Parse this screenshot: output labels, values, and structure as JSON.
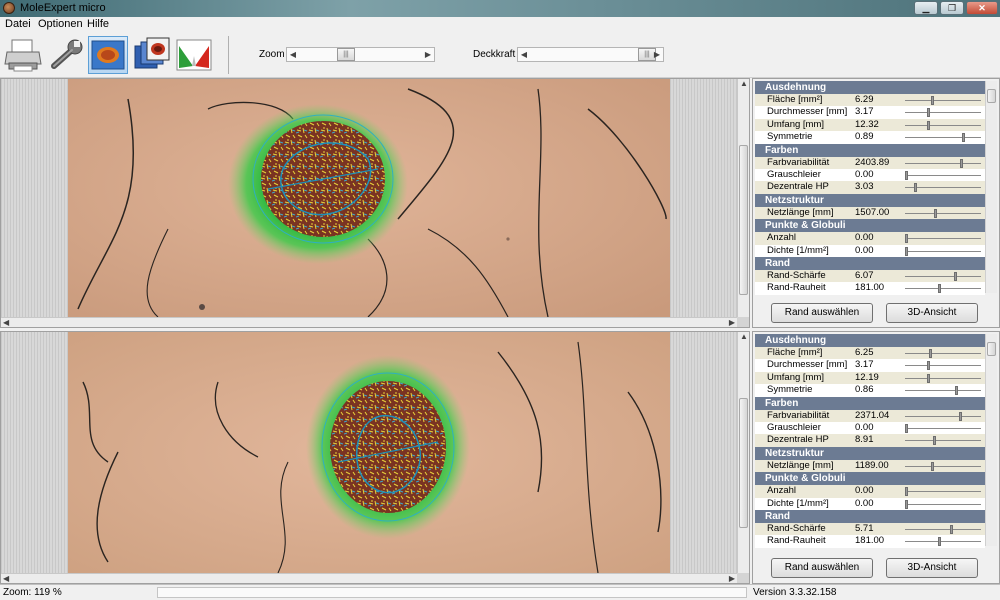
{
  "window": {
    "title": "MoleExpert micro"
  },
  "menu": [
    "Datei",
    "Optionen",
    "Hilfe"
  ],
  "toolbar": {
    "zoom_label": "Zoom",
    "opacity_label": "Deckkraft"
  },
  "panels": [
    {
      "sections": [
        {
          "title": "Ausdehnung",
          "rows": [
            {
              "name": "Fläche [mm²]",
              "value": "6.29",
              "level": 0.35
            },
            {
              "name": "Durchmesser [mm]",
              "value": "3.17",
              "level": 0.3
            },
            {
              "name": "Umfang [mm]",
              "value": "12.32",
              "level": 0.3
            },
            {
              "name": "Symmetrie",
              "value": "0.89",
              "level": 0.78
            }
          ]
        },
        {
          "title": "Farben",
          "rows": [
            {
              "name": "Farbvariabilität",
              "value": "2403.89",
              "level": 0.75
            },
            {
              "name": "Grauschleier",
              "value": "0.00",
              "level": 0.0
            },
            {
              "name": "Dezentrale HP",
              "value": "3.03",
              "level": 0.12
            }
          ]
        },
        {
          "title": "Netzstruktur",
          "rows": [
            {
              "name": "Netzlänge [mm]",
              "value": "1507.00",
              "level": 0.4
            }
          ]
        },
        {
          "title": "Punkte & Globuli",
          "rows": [
            {
              "name": "Anzahl",
              "value": "0.00",
              "level": 0.0
            },
            {
              "name": "Dichte [1/mm²]",
              "value": "0.00",
              "level": 0.0
            }
          ]
        },
        {
          "title": "Rand",
          "rows": [
            {
              "name": "Rand-Schärfe",
              "value": "6.07",
              "level": 0.67
            },
            {
              "name": "Rand-Rauheit",
              "value": "181.00",
              "level": 0.45
            }
          ]
        }
      ],
      "btn_border": "Rand auswählen",
      "btn_3d": "3D-Ansicht"
    },
    {
      "sections": [
        {
          "title": "Ausdehnung",
          "rows": [
            {
              "name": "Fläche [mm²]",
              "value": "6.25",
              "level": 0.33
            },
            {
              "name": "Durchmesser [mm]",
              "value": "3.17",
              "level": 0.3
            },
            {
              "name": "Umfang [mm]",
              "value": "12.19",
              "level": 0.3
            },
            {
              "name": "Symmetrie",
              "value": "0.86",
              "level": 0.68
            }
          ]
        },
        {
          "title": "Farben",
          "rows": [
            {
              "name": "Farbvariabilität",
              "value": "2371.04",
              "level": 0.74
            },
            {
              "name": "Grauschleier",
              "value": "0.00",
              "level": 0.0
            },
            {
              "name": "Dezentrale HP",
              "value": "8.91",
              "level": 0.38
            }
          ]
        },
        {
          "title": "Netzstruktur",
          "rows": [
            {
              "name": "Netzlänge [mm]",
              "value": "1189.00",
              "level": 0.35
            }
          ]
        },
        {
          "title": "Punkte & Globuli",
          "rows": [
            {
              "name": "Anzahl",
              "value": "0.00",
              "level": 0.0
            },
            {
              "name": "Dichte [1/mm²]",
              "value": "0.00",
              "level": 0.0
            }
          ]
        },
        {
          "title": "Rand",
          "rows": [
            {
              "name": "Rand-Schärfe",
              "value": "5.71",
              "level": 0.62
            },
            {
              "name": "Rand-Rauheit",
              "value": "181.00",
              "level": 0.45
            }
          ]
        }
      ],
      "btn_border": "Rand auswählen",
      "btn_3d": "3D-Ansicht"
    }
  ],
  "status": {
    "zoom": "Zoom: 119 %",
    "version": "Version 3.3.32.158"
  },
  "colors": {
    "section_header": "#6c7b93",
    "row_alt": "#ece9d8",
    "skin": "#d8a888",
    "lesion": "#7a3322",
    "halo": "#22c03a"
  },
  "icons": [
    "printer-icon",
    "wrench-icon",
    "lesion-view-icon",
    "image-stack-icon",
    "color-chart-icon"
  ]
}
